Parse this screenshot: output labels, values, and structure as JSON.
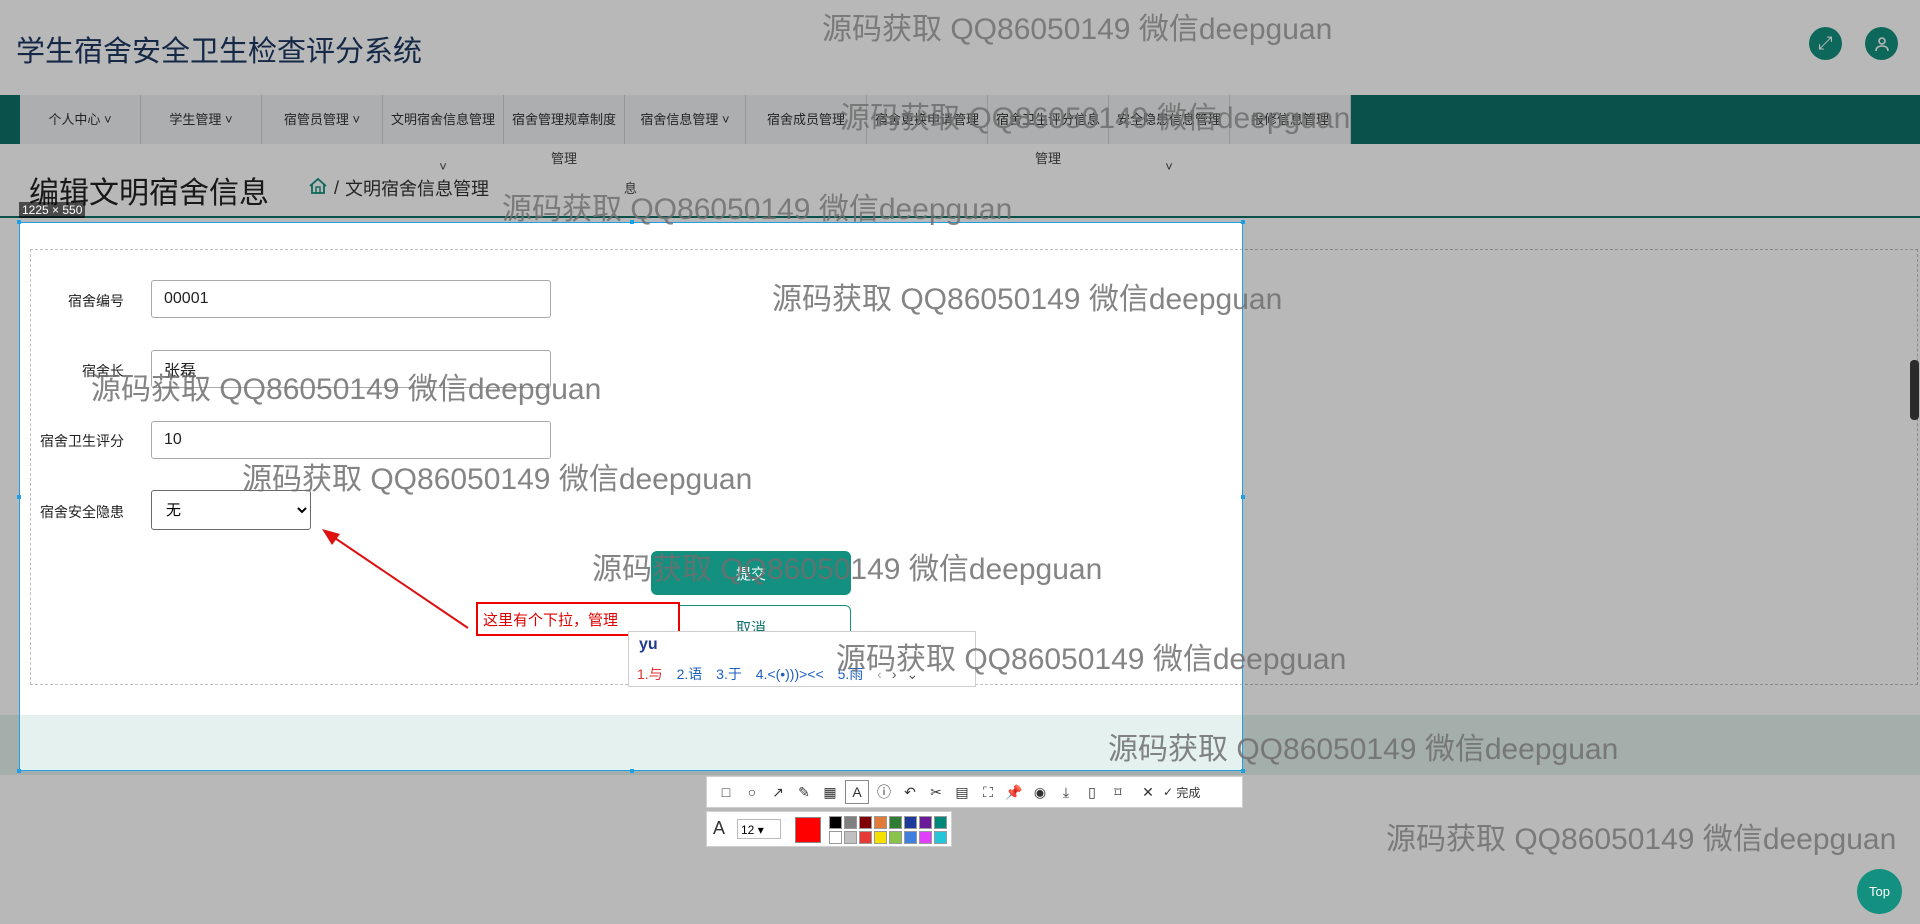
{
  "header": {
    "app_title": "学生宿舍安全卫生检查评分系统"
  },
  "nav": {
    "items": [
      {
        "label": "个人中心",
        "line2": ""
      },
      {
        "label": "学生管理",
        "line2": ""
      },
      {
        "label": "宿管员管理",
        "line2": ""
      },
      {
        "label": "文明宿舍信息管理",
        "line2": ""
      },
      {
        "label": "宿舍管理规章制度",
        "line2": "管理"
      },
      {
        "label": "宿舍信息管理",
        "line2": ""
      },
      {
        "label": "宿舍成员管理",
        "line2": ""
      },
      {
        "label": "宿舍更换申请管理",
        "line2": ""
      },
      {
        "label": "宿舍卫生评分信息",
        "line2": "管理"
      },
      {
        "label": "安全隐患信息管理",
        "line2": ""
      },
      {
        "label": "报修信息管理",
        "line2": ""
      }
    ]
  },
  "page": {
    "title": "编辑文明宿舍信息",
    "crumb_sep": "/",
    "crumb": "文明宿舍信息管理",
    "crumb2": "息"
  },
  "form": {
    "label_dorm_no": "宿舍编号",
    "value_dorm_no": "00001",
    "label_leader": "宿舍长",
    "value_leader": "张磊",
    "label_score": "宿舍卫生评分",
    "value_score": "10",
    "label_hazard": "宿舍安全隐患",
    "hazard_selected": "无",
    "submit_label": "提交",
    "cancel_label": "取消"
  },
  "capture": {
    "size_label": "1225 × 550",
    "annotation_text": "这里有个下拉，管理",
    "ime_input": "yu",
    "ime_candidates": [
      "1.与",
      "2.语",
      "3.于",
      "4.<(•)))><<",
      "5.雨"
    ],
    "font_size": "12",
    "done_label": "完成"
  },
  "watermark": "源码获取 QQ86050149 微信deepguan",
  "top_label": "Top",
  "colors": {
    "accent": "#13907f",
    "nav_bg": "#0f7068",
    "annotation": "#e00000"
  }
}
